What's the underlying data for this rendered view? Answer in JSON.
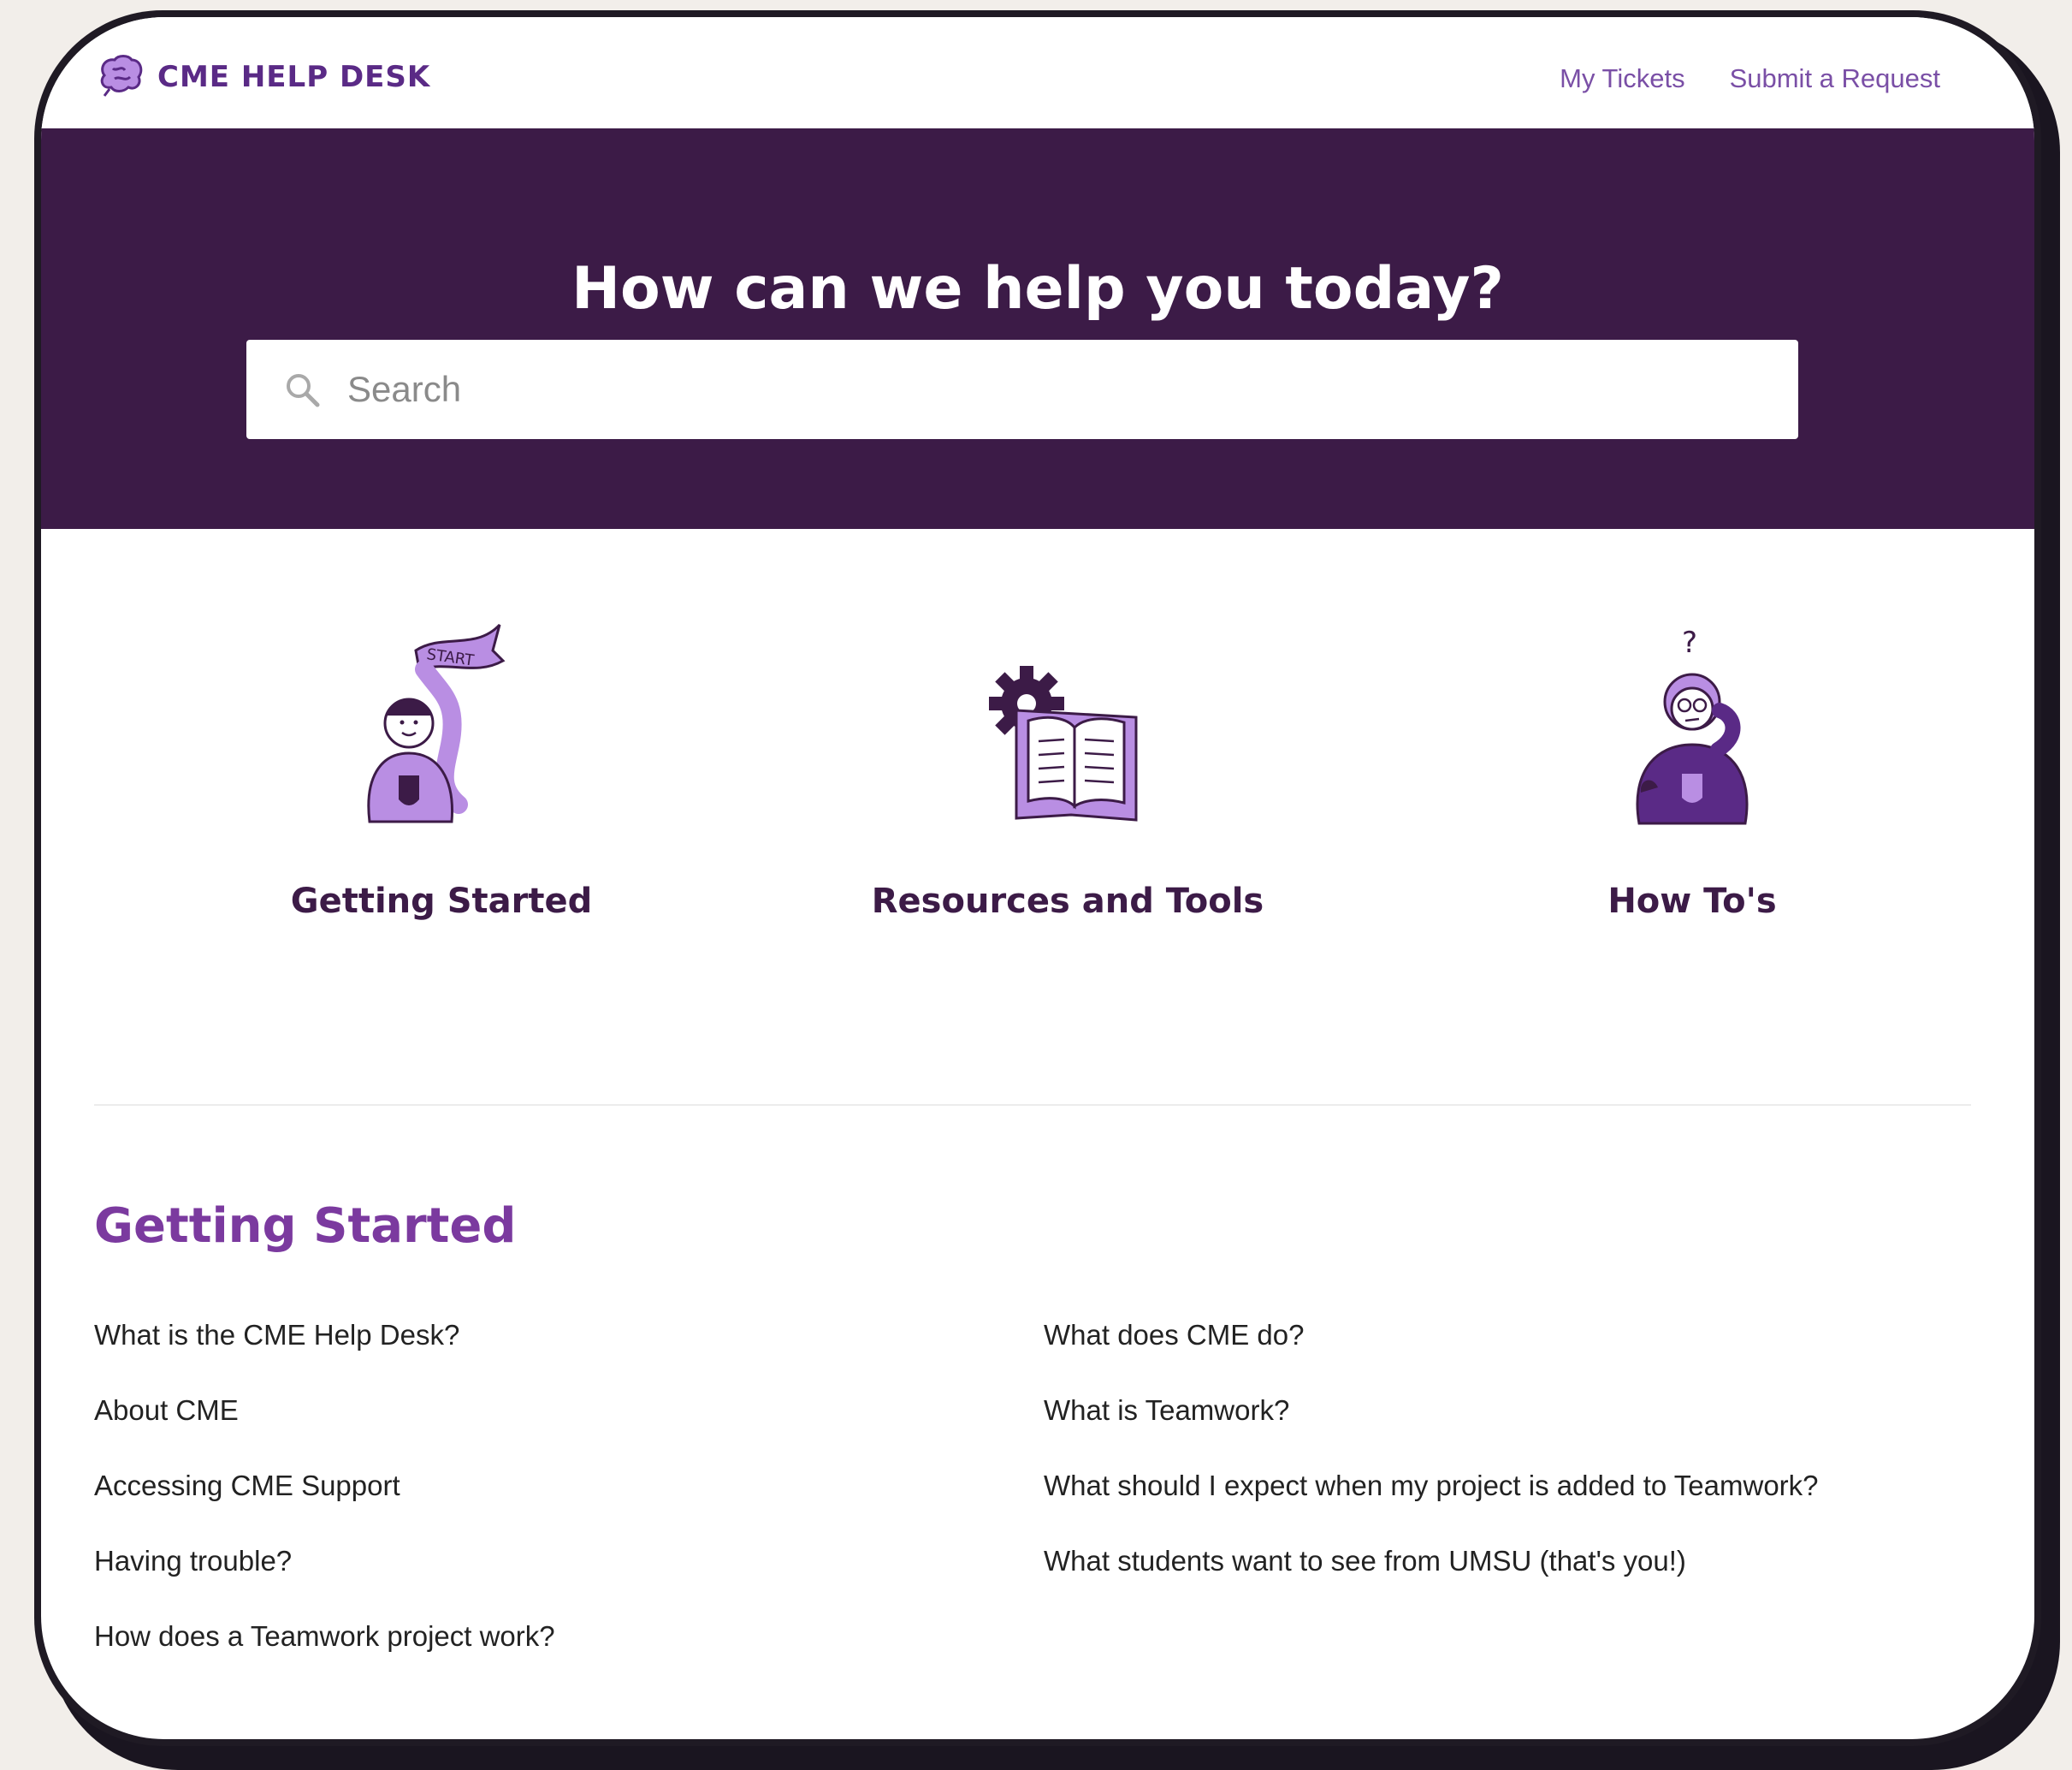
{
  "header": {
    "logo_text": "CME HELP DESK",
    "nav": {
      "my_tickets": "My Tickets",
      "submit_request": "Submit a Request"
    }
  },
  "hero": {
    "title": "How can we help you today?",
    "search_placeholder": "Search"
  },
  "categories": [
    {
      "label": "Getting Started",
      "banner_text": "START"
    },
    {
      "label": "Resources and Tools"
    },
    {
      "label": "How To's",
      "mark": "?"
    }
  ],
  "section": {
    "title": "Getting Started",
    "left_articles": [
      "What is the CME Help Desk?",
      "About CME",
      "Accessing CME Support",
      "Having trouble?",
      "How does a Teamwork project work?"
    ],
    "right_articles": [
      "What does CME do?",
      "What is Teamwork?",
      "What should I expect when my project is added to Teamwork?",
      "What students want to see from UMSU (that's you!)"
    ]
  },
  "colors": {
    "brand_dark": "#3c1b47",
    "brand_purple": "#7b3a9f",
    "link_purple": "#7a4fa6",
    "illustration_lilac": "#b98ee3"
  }
}
